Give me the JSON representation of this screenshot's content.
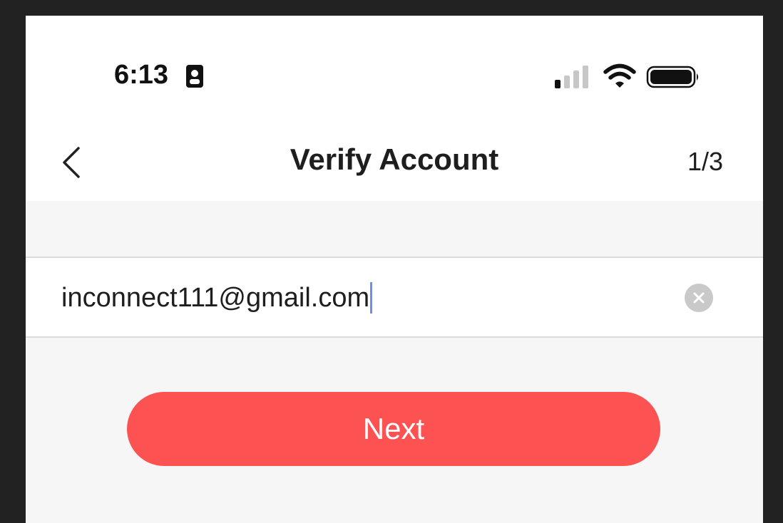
{
  "status_bar": {
    "time": "6:13",
    "icons": [
      "contact-card-icon",
      "cellular-signal-icon",
      "wifi-icon",
      "battery-icon"
    ]
  },
  "nav_bar": {
    "back_icon": "chevron-left-icon",
    "title": "Verify Account",
    "step": "1/3"
  },
  "form": {
    "email_value": "inconnect111@gmail.com",
    "clear_icon": "clear-x-icon",
    "next_label": "Next"
  },
  "colors": {
    "accent": "#fc5252",
    "caret": "#6f8fe6",
    "background": "#f6f6f6"
  }
}
